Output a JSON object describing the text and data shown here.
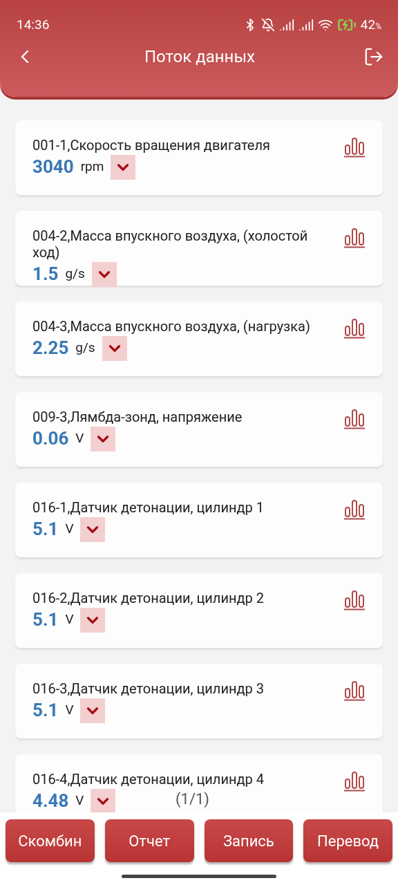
{
  "status_bar": {
    "time": "14:36",
    "battery": "42",
    "battery_unit": "%"
  },
  "header": {
    "title": "Поток данных"
  },
  "params": [
    {
      "name": "001-1,Скорость вращения двигателя",
      "value": "3040",
      "unit": "rpm"
    },
    {
      "name": "004-2,Масса впускного воздуха, (холостой ход)",
      "value": "1.5",
      "unit": "g/s"
    },
    {
      "name": "004-3,Масса впускного воздуха, (нагрузка)",
      "value": "2.25",
      "unit": "g/s"
    },
    {
      "name": "009-3,Лямбда-зонд, напряжение",
      "value": "0.06",
      "unit": "V"
    },
    {
      "name": "016-1,Датчик детонации, цилиндр 1",
      "value": "5.1",
      "unit": "V"
    },
    {
      "name": "016-2,Датчик детонации, цилиндр 2",
      "value": "5.1",
      "unit": "V"
    },
    {
      "name": "016-3,Датчик детонации, цилиндр 3",
      "value": "5.1",
      "unit": "V"
    },
    {
      "name": "016-4,Датчик детонации, цилиндр 4",
      "value": "4.48",
      "unit": "V"
    }
  ],
  "page_indicator": "(1/1)",
  "buttons": [
    "Скомбин",
    "Отчет",
    "Запись",
    "Перевод"
  ]
}
